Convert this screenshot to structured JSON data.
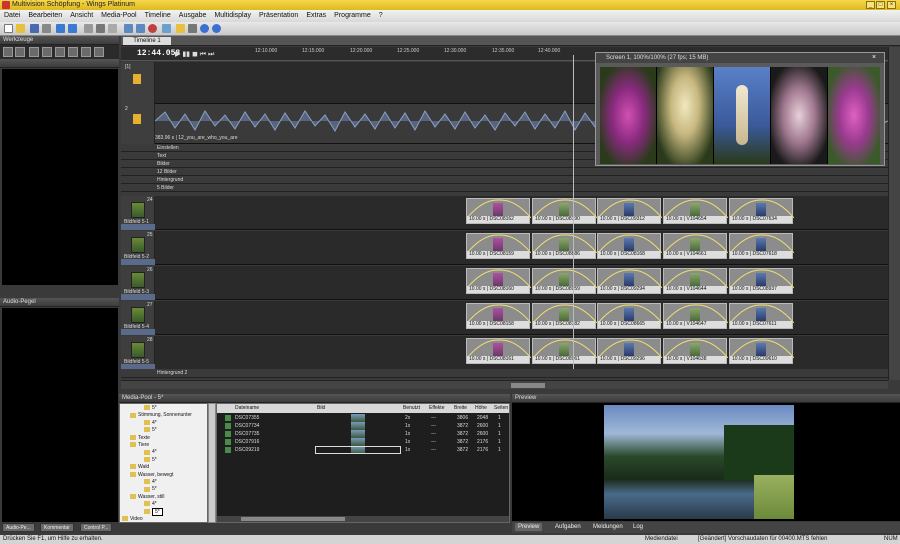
{
  "window": {
    "title": "Multivision Schöpfung - Wings Platinum"
  },
  "menu": [
    "Datei",
    "Bearbeiten",
    "Ansicht",
    "Media-Pool",
    "Timeline",
    "Ausgabe",
    "Multidisplay",
    "Präsentation",
    "Extras",
    "Programme",
    "?"
  ],
  "panels": {
    "werkzeuge": "Werkzeuge",
    "audio_pegel": "Audio-Pegel",
    "media_pool": "Media-Pool - 5*",
    "preview": "Preview"
  },
  "timeline": {
    "tab": "Timeline 1",
    "time": "12:44.058",
    "ticks": [
      "12:10.000",
      "12:15.000",
      "12:20.000",
      "12:25.000",
      "12:30.000",
      "12:35.000",
      "12:40.000"
    ],
    "audio_label": "383.96 s | 12_you_are_who_you_are",
    "subtracks": [
      "Einstellen",
      "Text",
      "Bilder",
      "12 Bilder",
      "Hintergrund",
      "5 Bilder"
    ],
    "tracks": [
      {
        "num": "24",
        "name": "Bildfeld 5-1",
        "clips": [
          "10.00 s | DSC08162",
          "10.00 s | DSC08190",
          "10.00 s | DSC09312",
          "10.00 s | V104654",
          "10.00 s | DSC07634"
        ]
      },
      {
        "num": "25",
        "name": "Bildfeld 5-2",
        "clips": [
          "10.00 s | DSC08159",
          "10.00 s | DSC08886",
          "10.00 s | DSC08168",
          "10.00 s | V104661",
          "10.00 s | DSC07618"
        ]
      },
      {
        "num": "26",
        "name": "Bildfeld 5-3",
        "clips": [
          "10.00 s | DSC08160",
          "10.00 s | DSC08959",
          "10.00 s | DSC09294",
          "10.00 s | V104644",
          "10.00 s | DSC08937"
        ]
      },
      {
        "num": "27",
        "name": "Bildfeld 5-4",
        "clips": [
          "10.00 s | DSC08158",
          "10.00 s | DSC08182",
          "10.00 s | DSC08665",
          "10.00 s | V104647",
          "10.00 s | DSC07611"
        ]
      },
      {
        "num": "28",
        "name": "Bildfeld 5-5",
        "clips": [
          "10.00 s | DSC08161",
          "10.00 s | DSC08961",
          "10.00 s | DSC09296",
          "10.00 s | V104638",
          "10.00 s | DSC09610"
        ]
      }
    ],
    "footer_track": "Hintergrund 2",
    "screen_window": "Screen 1, 100%/100% (27 fps; 15 MB)"
  },
  "media_pool": {
    "tree": [
      "5*",
      "Stimmung, Sonnenunter",
      "4*",
      "5*",
      "Texte",
      "Tiere",
      "4*",
      "5*",
      "Wald",
      "Wasser, bewegt",
      "4*",
      "5*",
      "Wasser, still",
      "4*",
      "5*",
      "Video"
    ],
    "headers": [
      "Dateiname",
      "Bild",
      "Benutzt",
      "Effekte",
      "Breite",
      "Höhe",
      "Seiten"
    ],
    "rows": [
      [
        "DSC07355",
        "",
        "2x",
        "---",
        "3806",
        "2048",
        "1"
      ],
      [
        "DSC07734",
        "",
        "1x",
        "---",
        "3872",
        "2600",
        "1"
      ],
      [
        "DSC07735",
        "",
        "1x",
        "---",
        "3872",
        "2600",
        "1"
      ],
      [
        "DSC07916",
        "",
        "1x",
        "---",
        "3872",
        "2176",
        "1"
      ],
      [
        "DSC09219",
        "",
        "1x",
        "---",
        "3872",
        "2176",
        "1"
      ]
    ]
  },
  "bottom_tabs": [
    "Audio-Pe...",
    "Kommentar",
    "Control P..."
  ],
  "preview_tabs": [
    "Preview",
    "Aufgaben",
    "Meldungen",
    "Log"
  ],
  "status": {
    "left": "Drücken Sie F1, um Hilfe zu erhalten.",
    "mid": "Mediendatei",
    "right": "[Geändert] Vorschaudaten für 00400.MTS fehlen",
    "num": "NUM"
  }
}
